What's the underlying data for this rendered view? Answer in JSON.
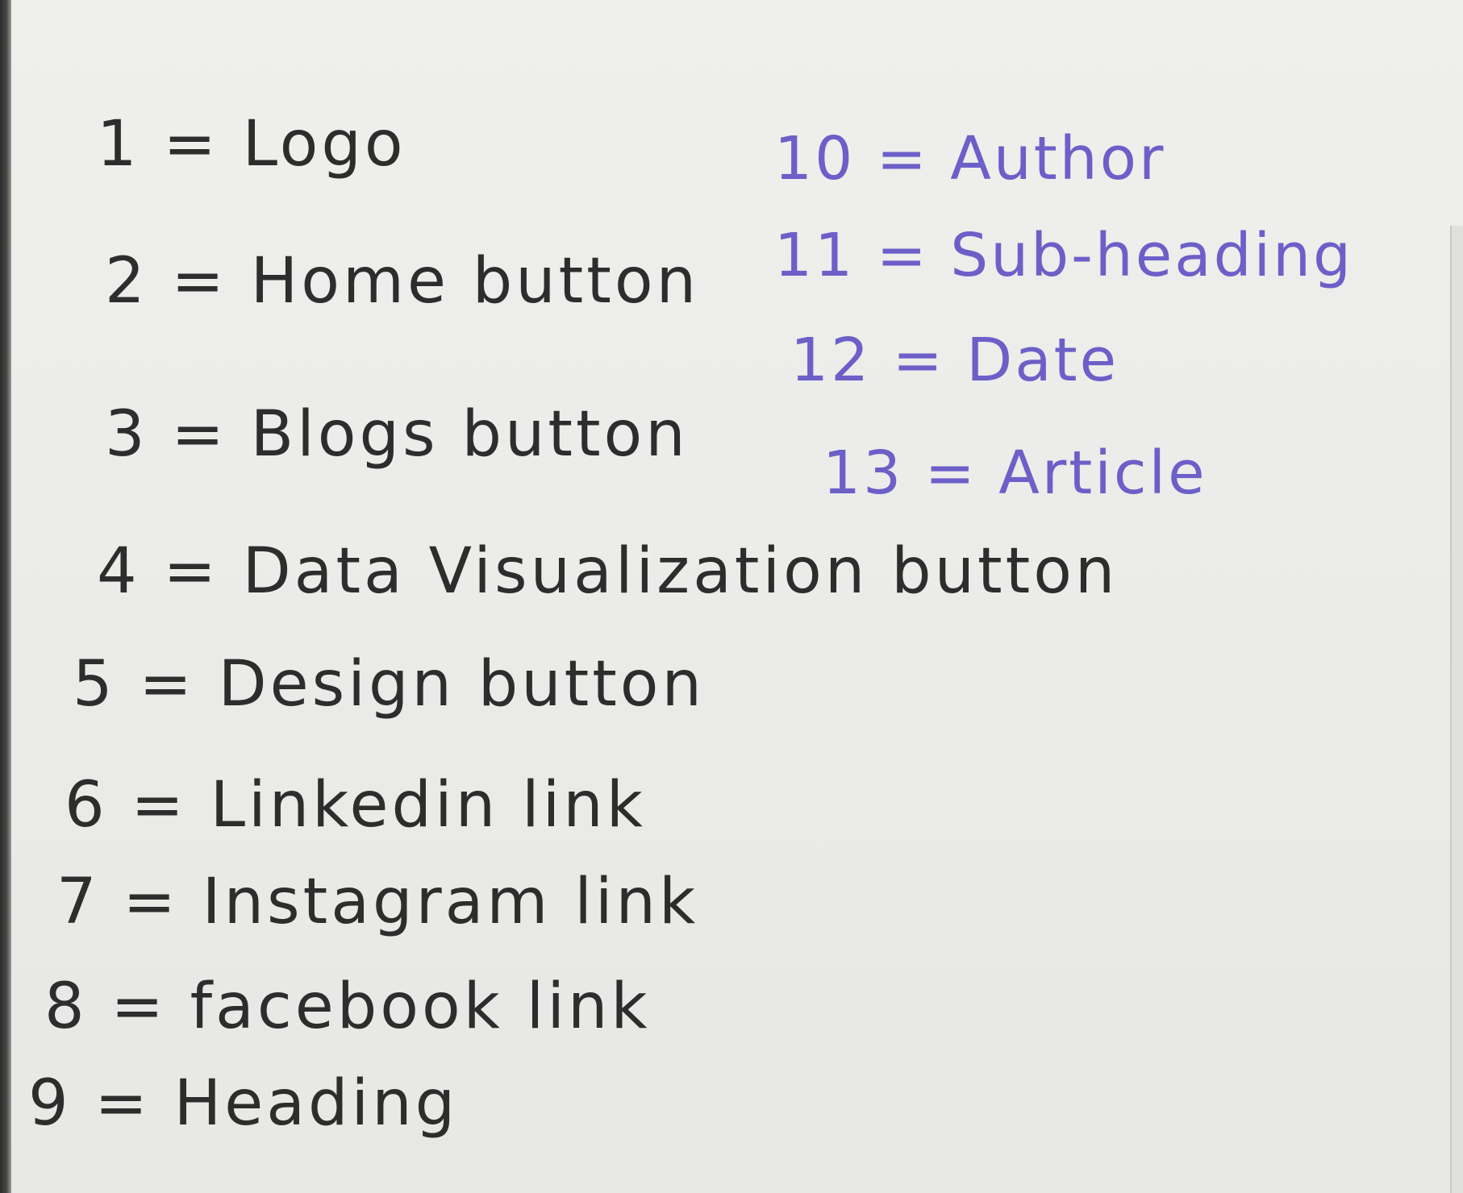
{
  "legend": {
    "left_column": [
      {
        "number": "1",
        "label": "Logo"
      },
      {
        "number": "2",
        "label": "Home button"
      },
      {
        "number": "3",
        "label": "Blogs button"
      },
      {
        "number": "4",
        "label": "Data Visualization button"
      },
      {
        "number": "5",
        "label": "Design button"
      },
      {
        "number": "6",
        "label": "Linkedin link"
      },
      {
        "number": "7",
        "label": "Instagram link"
      },
      {
        "number": "8",
        "label": "facebook link"
      },
      {
        "number": "9",
        "label": "Heading"
      }
    ],
    "right_column": [
      {
        "number": "10",
        "label": "Author"
      },
      {
        "number": "11",
        "label": "Sub-heading"
      },
      {
        "number": "12",
        "label": "Date"
      },
      {
        "number": "13",
        "label": "Article"
      }
    ],
    "separator": "=",
    "colors": {
      "pencil": "#2d2d2d",
      "ink": "#6d5fc8",
      "paper": "#ececea"
    }
  }
}
